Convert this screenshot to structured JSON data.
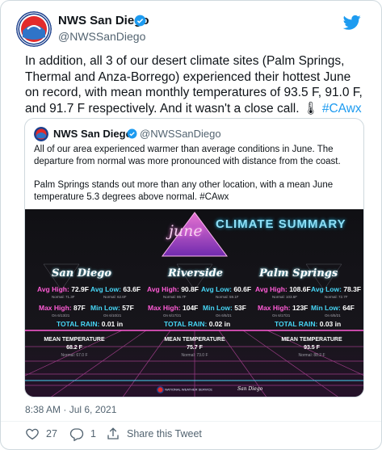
{
  "tweet": {
    "author_name": "NWS San Diego",
    "author_handle": "@NWSSanDiego",
    "avatar_icon": "nws-logo-icon",
    "brand_icon": "twitter-bird-icon",
    "text_main": "In addition, all 3 of our desert climate sites (Palm Springs, Thermal and Anza-Borrego) experienced their hottest June on record, with mean monthly temperatures of 93.5 F, 91.0 F, and 91.7 F respectively. And it wasn't a close call.",
    "text_emoji": "🌡",
    "hashtag": "#CAwx",
    "timestamp": "8:38 AM · Jul 6, 2021",
    "likes": "27",
    "replies": "1",
    "share_label": "Share this Tweet",
    "colors": {
      "link": "#1d9bf0",
      "muted": "#536471",
      "border": "#cfd9de"
    }
  },
  "quote": {
    "author_name": "NWS San Diego",
    "author_handle": "@NWSSanDiego",
    "para1": "All of our area experienced warmer than average conditions in June. The departure from normal was more pronounced with distance from the coast.",
    "para2": "Palm Springs stands out more than any other location, with a mean June temperature 5.3 degrees above normal. #CAwx"
  },
  "card": {
    "title": "CLIMATE SUMMARY",
    "month": "june",
    "colors": {
      "pink": "#ff5bd6",
      "cyan": "#47d6f6",
      "bg": "#141417"
    },
    "sites": [
      {
        "name": "San Diego",
        "avg_high_label": "Avg High:",
        "avg_high": "72.9F",
        "avg_high_normal": "Normal: 71.3F",
        "avg_low_label": "Avg Low:",
        "avg_low": "63.6F",
        "avg_low_normal": "Normal: 62.6F",
        "max_high_label": "Max High:",
        "max_high": "87F",
        "max_high_date": "On 6/13/21",
        "min_low_label": "Min Low:",
        "min_low": "57F",
        "min_low_date": "On 6/10/21",
        "rain_label": "TOTAL RAIN:",
        "rain": "0.01 in",
        "mean_label": "MEAN TEMPERATURE",
        "mean": "68.2 F",
        "mean_normal": "Normal: 67.0 F"
      },
      {
        "name": "Riverside",
        "avg_high_label": "Avg High:",
        "avg_high": "90.8F",
        "avg_high_normal": "Normal: 86.7F",
        "avg_low_label": "Avg Low:",
        "avg_low": "60.6F",
        "avg_low_normal": "Normal: 59.1F",
        "max_high_label": "Max High:",
        "max_high": "104F",
        "max_high_date": "On 6/17/21",
        "min_low_label": "Min Low:",
        "min_low": "53F",
        "min_low_date": "On 6/5/21",
        "rain_label": "TOTAL RAIN:",
        "rain": "0.02 in",
        "mean_label": "MEAN TEMPERATURE",
        "mean": "75.7 F",
        "mean_normal": "Normal: 73.0 F"
      },
      {
        "name": "Palm Springs",
        "avg_high_label": "Avg High:",
        "avg_high": "108.6F",
        "avg_high_normal": "Normal: 103.6F",
        "avg_low_label": "Avg Low:",
        "avg_low": "78.3F",
        "avg_low_normal": "Normal: 72.7F",
        "max_high_label": "Max High:",
        "max_high": "123F",
        "max_high_date": "On 6/17/21",
        "min_low_label": "Min Low:",
        "min_low": "64F",
        "min_low_date": "On 6/5/21",
        "rain_label": "TOTAL RAIN:",
        "rain": "0.03 in",
        "mean_label": "MEAN TEMPERATURE",
        "mean": "93.5 F",
        "mean_normal": "Normal: 88.2 F"
      }
    ],
    "footer_org": "NATIONAL WEATHER SERVICE",
    "footer_office": "San Diego"
  }
}
